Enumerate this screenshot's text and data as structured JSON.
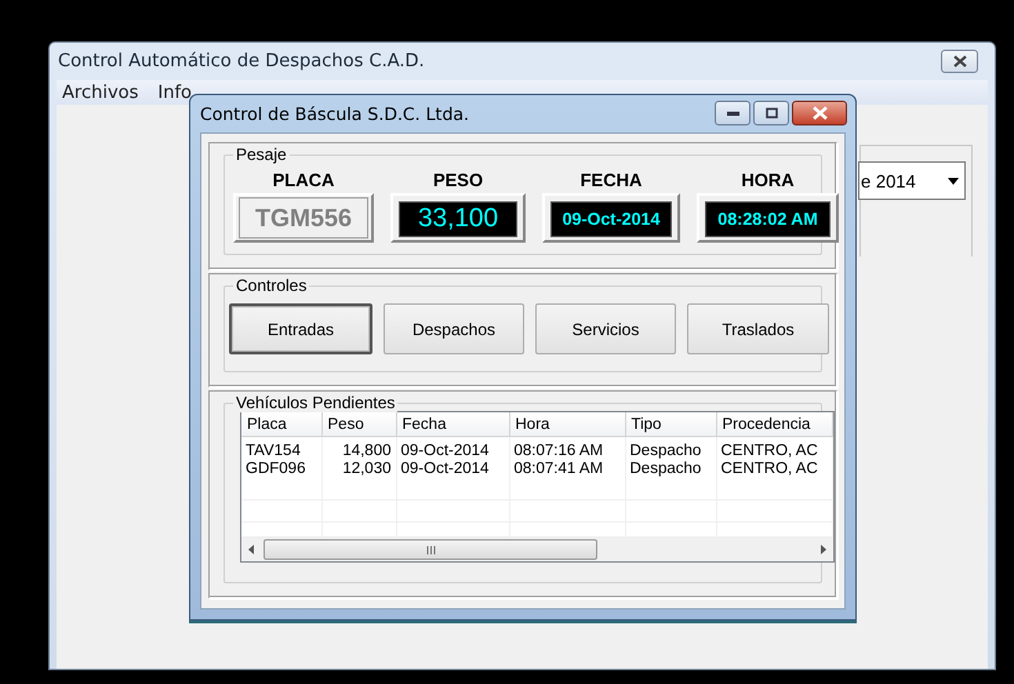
{
  "main_window": {
    "title": "Control Automático de Despachos C.A.D.",
    "menu": [
      "Archivos",
      "Info"
    ],
    "combo": {
      "value": "e 2014"
    }
  },
  "dialog": {
    "title": "Control de Báscula S.D.C. Ltda.",
    "pesaje": {
      "title": "Pesaje",
      "fields": [
        {
          "label": "PLACA",
          "value": "TGM556",
          "kind": "plate"
        },
        {
          "label": "PESO",
          "value": "33,100",
          "kind": "lcd"
        },
        {
          "label": "FECHA",
          "value": "09-Oct-2014",
          "kind": "lcd"
        },
        {
          "label": "HORA",
          "value": "08:28:02 AM",
          "kind": "lcd"
        }
      ]
    },
    "controles": {
      "title": "Controles",
      "buttons": [
        {
          "label": "Entradas",
          "default": true
        },
        {
          "label": "Despachos",
          "default": false
        },
        {
          "label": "Servicios",
          "default": false
        },
        {
          "label": "Traslados",
          "default": false
        }
      ]
    },
    "pendientes": {
      "title": "Vehículos Pendientes",
      "columns": [
        "Placa",
        "Peso",
        "Fecha",
        "Hora",
        "Tipo",
        "Procedencia"
      ],
      "rows": [
        [
          "TAV154",
          "14,800",
          "09-Oct-2014",
          "08:07:16 AM",
          "Despacho",
          "CENTRO, AC"
        ],
        [
          "GDF096",
          "12,030",
          "09-Oct-2014",
          "08:07:41 AM",
          "Despacho",
          "CENTRO, AC"
        ]
      ]
    }
  }
}
